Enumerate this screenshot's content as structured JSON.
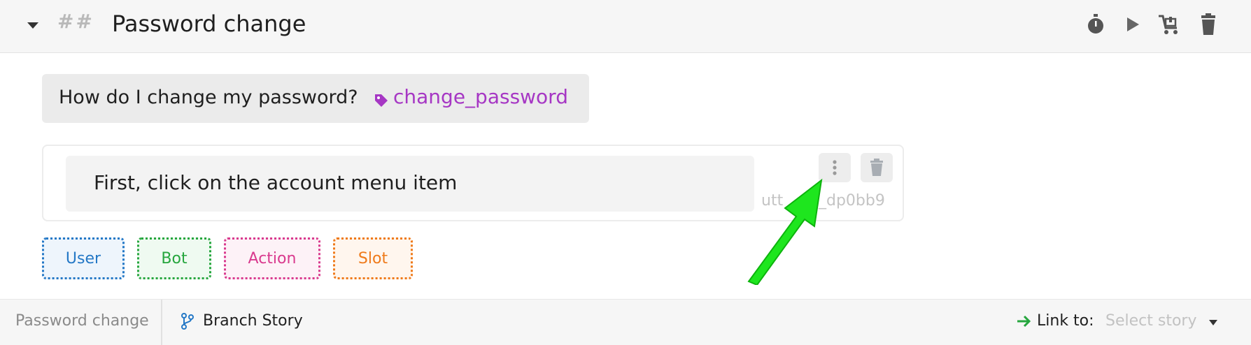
{
  "header": {
    "collapse_icon": "caret-down-icon",
    "markdown_prefix": "##",
    "title": "Password change",
    "actions": [
      {
        "name": "timer-icon"
      },
      {
        "name": "play-icon"
      },
      {
        "name": "cart-icon"
      },
      {
        "name": "trash-icon"
      }
    ]
  },
  "user_message": {
    "text": "How do I change my password?",
    "intent": "change_password",
    "intent_color": "#a637c4"
  },
  "bot_message": {
    "text": "First, click on the account menu item",
    "id_partial_left": "utt",
    "id_partial_right": "_dp0bb9"
  },
  "add_buttons": [
    {
      "label": "User",
      "color": "#2478c6",
      "bg": "#eef5fc"
    },
    {
      "label": "Bot",
      "color": "#26a63e",
      "bg": "#effaf1"
    },
    {
      "label": "Action",
      "color": "#d93a8e",
      "bg": "#fdf2f7"
    },
    {
      "label": "Slot",
      "color": "#ef7a1a",
      "bg": "#fff6ee"
    }
  ],
  "annotation": {
    "arrow_color": "#1ee61e"
  },
  "footer": {
    "story_name": "Password change",
    "branch_label": "Branch Story",
    "link_label": "Link to:",
    "select_placeholder": "Select story"
  }
}
